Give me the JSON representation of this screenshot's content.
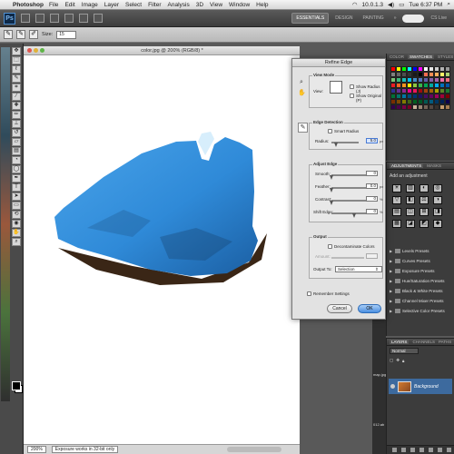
{
  "menubar": {
    "app_name": "Photoshop",
    "menus": [
      "File",
      "Edit",
      "Image",
      "Layer",
      "Select",
      "Filter",
      "Analysis",
      "3D",
      "View",
      "Window",
      "Help"
    ],
    "ip": "10.0.1.3",
    "clock": "Tue 6:37 PM"
  },
  "appbar": {
    "logo": "Ps",
    "workspaces": [
      "ESSENTIALS",
      "DESIGN",
      "PAINTING"
    ],
    "more": "»",
    "cslive": "CS Live"
  },
  "options": {
    "size_label": "Size:",
    "size_value": "15"
  },
  "document": {
    "title": "color.jpg @ 200% (RGB/8) *",
    "zoom": "200%",
    "status": "Exposure works in 32-bit only",
    "image_colors": {
      "fill": "#2f8ad8",
      "shadow": "#16426e",
      "light": "#d7eefc",
      "edge": "#3a2616"
    }
  },
  "dialog": {
    "title": "Refine Edge",
    "view_mode": {
      "group_label": "View Mode",
      "view_label": "View:",
      "show_radius": "Show Radius (J)",
      "show_original": "Show Original (P)"
    },
    "edge_detection": {
      "group_label": "Edge Detection",
      "smart_radius": "Smart Radius",
      "radius_label": "Radius:",
      "radius_value": "5.0",
      "radius_unit": "px"
    },
    "adjust_edge": {
      "group_label": "Adjust Edge",
      "smooth_label": "Smooth:",
      "smooth_value": "0",
      "feather_label": "Feather:",
      "feather_value": "0.0",
      "feather_unit": "px",
      "contrast_label": "Contrast:",
      "contrast_value": "0",
      "contrast_unit": "%",
      "shift_label": "Shift Edge:",
      "shift_value": "0",
      "shift_unit": "%"
    },
    "output": {
      "group_label": "Output",
      "decontaminate": "Decontaminate Colors",
      "amount_label": "Amount:",
      "output_to_label": "Output To:",
      "output_to_value": "Selection"
    },
    "remember": "Remember Settings",
    "cancel": "Cancel",
    "ok": "OK"
  },
  "swatches": {
    "tabs": [
      "COLOR",
      "SWATCHES",
      "STYLES"
    ],
    "colors": [
      "#ff0000",
      "#ffff00",
      "#00ff00",
      "#00ffff",
      "#0000ff",
      "#ff00ff",
      "#ffffff",
      "#e6e6e6",
      "#cccccc",
      "#b3b3b3",
      "#999999",
      "#808080",
      "#666666",
      "#4d4d4d",
      "#333333",
      "#1a1a1a",
      "#000000",
      "#f26c4f",
      "#f68e55",
      "#fbaf5c",
      "#fff467",
      "#acd372",
      "#7cc576",
      "#3bb878",
      "#1abbb4",
      "#00bff3",
      "#438cca",
      "#5574b9",
      "#605ca8",
      "#855fa8",
      "#a763a8",
      "#f06ea9",
      "#f26d7d",
      "#ed1c24",
      "#f26522",
      "#f7941d",
      "#fff200",
      "#8dc73f",
      "#39b54a",
      "#00a651",
      "#00a99d",
      "#00aeef",
      "#0072bc",
      "#0054a6",
      "#2e3192",
      "#662d91",
      "#92278f",
      "#ec008c",
      "#ed145b",
      "#9e0b0f",
      "#a0410d",
      "#a36209",
      "#aba000",
      "#598527",
      "#1a7b30",
      "#007236",
      "#00746b",
      "#0076a3",
      "#004b80",
      "#003471",
      "#1b1464",
      "#440e62",
      "#630460",
      "#9e005d",
      "#9e0039",
      "#790000",
      "#7b2e00",
      "#7d4900",
      "#827b00",
      "#406618",
      "#005e20",
      "#005826",
      "#005952",
      "#005b7f",
      "#003663",
      "#002157",
      "#0d004c",
      "#32004b",
      "#4b0049",
      "#7b0046",
      "#7a0026",
      "#c7b299",
      "#998675",
      "#736357",
      "#534741",
      "#37302d",
      "#c69c6d",
      "#a67c52"
    ]
  },
  "adjustments": {
    "tabs": [
      "ADJUSTMENTS",
      "MASKS"
    ],
    "title": "Add an adjustment",
    "icons": [
      "☀",
      "▥",
      "◐",
      "◎",
      "▽",
      "◧",
      "⚖",
      "◑",
      "▤",
      "◫",
      "⊞",
      "◨",
      "▦",
      "◪",
      "◩",
      "◆"
    ],
    "presets": [
      "Levels Presets",
      "Curves Presets",
      "Exposure Presets",
      "Hue/Saturation Presets",
      "Black & White Presets",
      "Channel Mixer Presets",
      "Selective Color Presets"
    ]
  },
  "layers": {
    "tabs": [
      "LAYERS",
      "CHANNELS",
      "PATHS"
    ],
    "blend_mode": "Normal",
    "layer_name": "Background"
  },
  "side_text": [
    "map.jpg",
    "012.ab"
  ]
}
